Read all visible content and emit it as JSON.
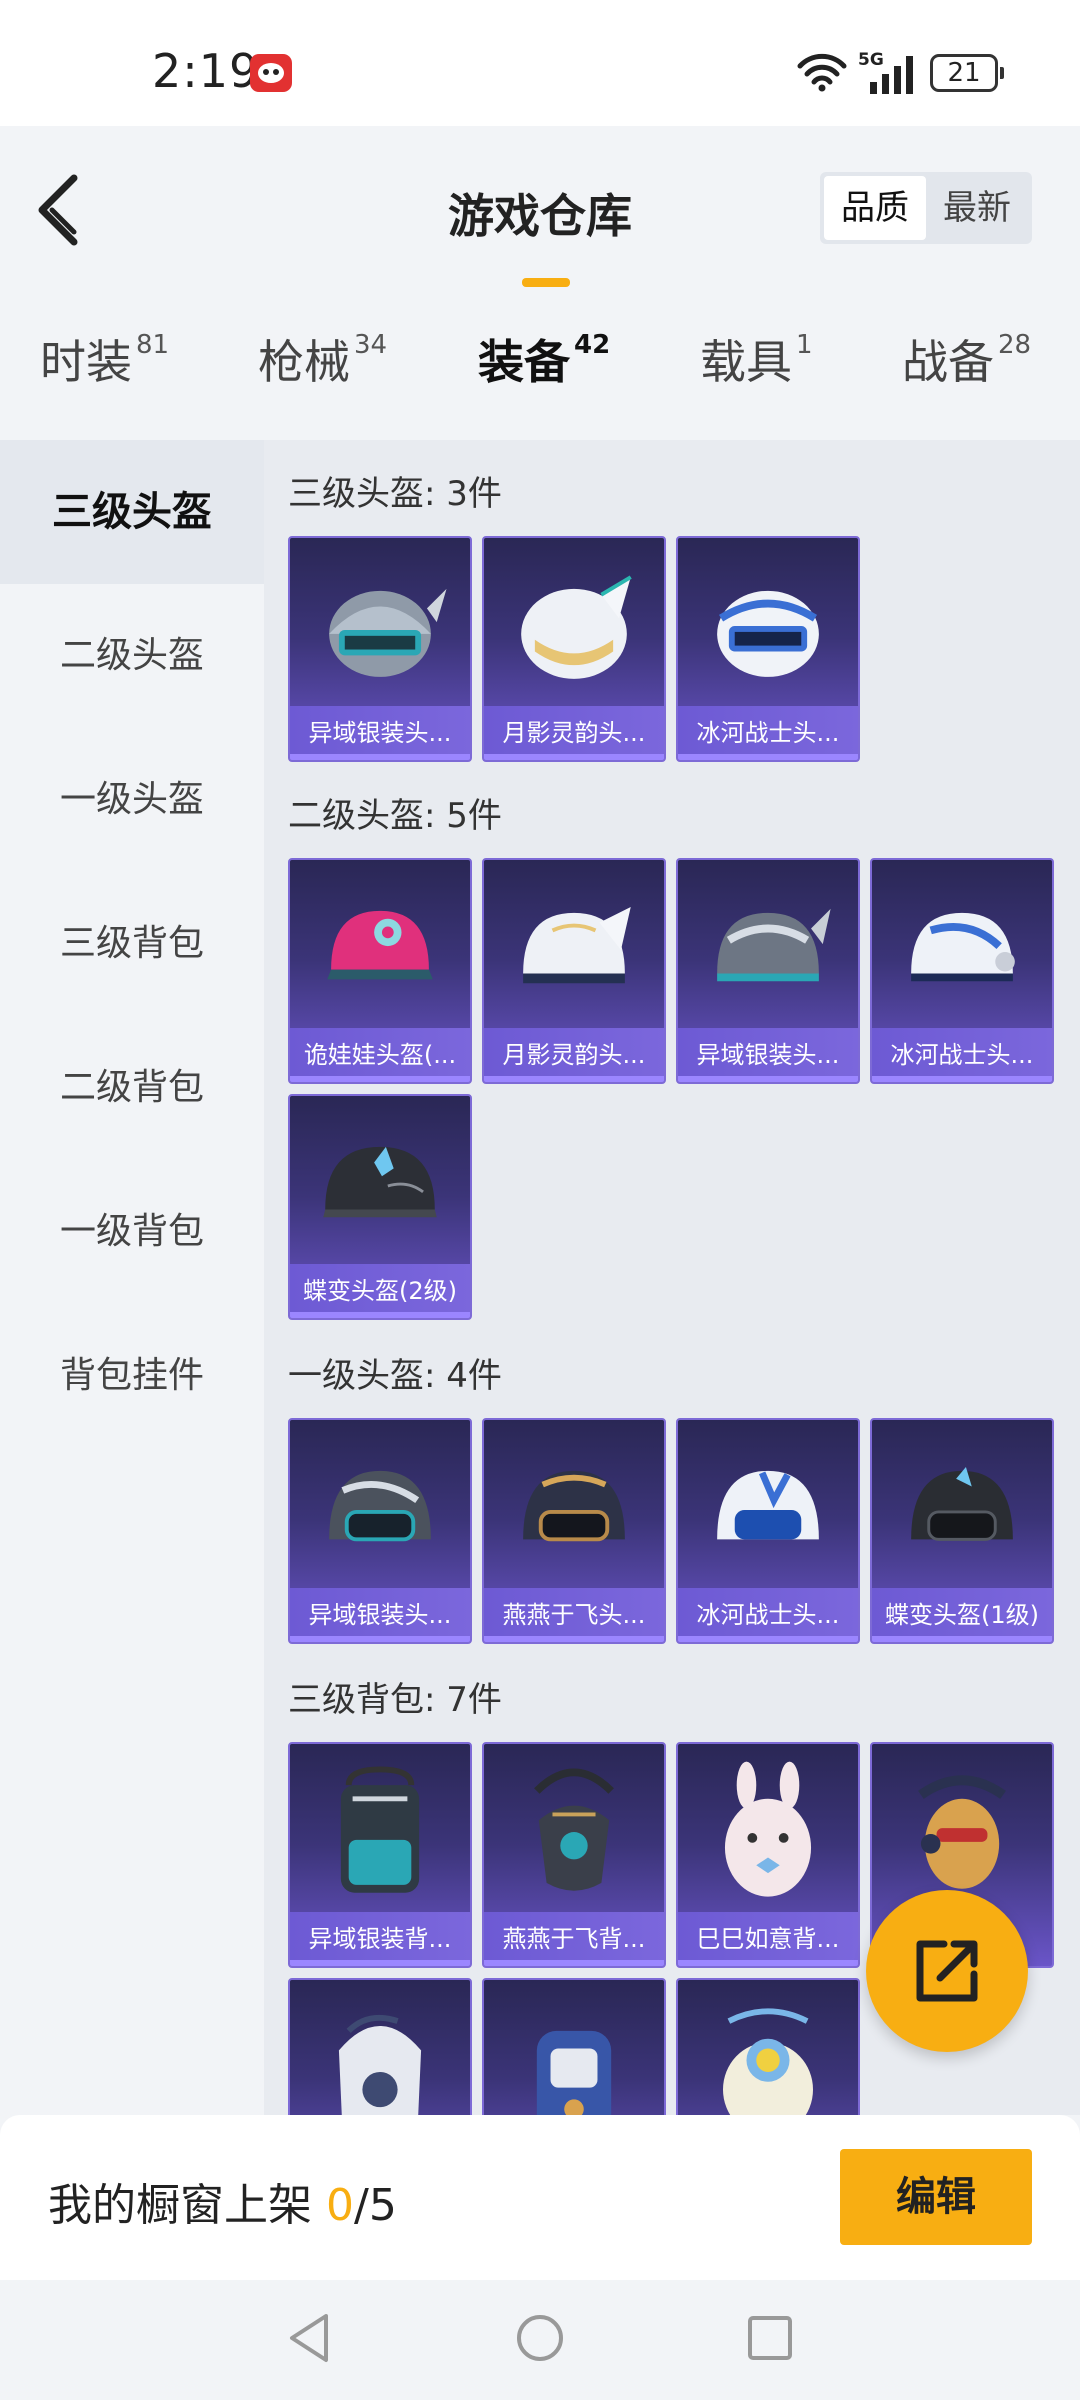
{
  "status_bar": {
    "time": "2:19",
    "network": "5G",
    "battery": "21"
  },
  "header": {
    "title": "游戏仓库",
    "sort_options": [
      "品质",
      "最新"
    ],
    "sort_active": "品质"
  },
  "tabs": [
    {
      "label": "时装",
      "count": "81",
      "active": false
    },
    {
      "label": "枪械",
      "count": "34",
      "active": false
    },
    {
      "label": "装备",
      "count": "42",
      "active": true
    },
    {
      "label": "载具",
      "count": "1",
      "active": false
    },
    {
      "label": "战备",
      "count": "28",
      "active": false
    }
  ],
  "sidebar": {
    "items": [
      {
        "label": "三级头盔",
        "active": true
      },
      {
        "label": "二级头盔",
        "active": false
      },
      {
        "label": "一级头盔",
        "active": false
      },
      {
        "label": "三级背包",
        "active": false
      },
      {
        "label": "二级背包",
        "active": false
      },
      {
        "label": "一级背包",
        "active": false
      },
      {
        "label": "背包挂件",
        "active": false
      }
    ]
  },
  "sections": [
    {
      "title": "三级头盔: 3件",
      "items": [
        {
          "name": "异域银装头...",
          "icon": "helmet-visor-icon"
        },
        {
          "name": "月影灵韵头...",
          "icon": "helmet-white-gold-icon"
        },
        {
          "name": "冰河战士头...",
          "icon": "helmet-visor-blue-icon"
        }
      ]
    },
    {
      "title": "二级头盔: 5件",
      "items": [
        {
          "name": "诡娃娃头盔(...",
          "icon": "helmet-pink-icon"
        },
        {
          "name": "月影灵韵头...",
          "icon": "helmet-white-gold-icon"
        },
        {
          "name": "异域银装头...",
          "icon": "helmet-silver-icon"
        },
        {
          "name": "冰河战士头...",
          "icon": "helmet-white-blue-icon"
        },
        {
          "name": "蝶变头盔(2级)",
          "icon": "helmet-black-icon"
        }
      ]
    },
    {
      "title": "一级头盔: 4件",
      "items": [
        {
          "name": "异域银装头...",
          "icon": "helmet-silver-icon"
        },
        {
          "name": "燕燕于飞头...",
          "icon": "helmet-dark-gold-icon"
        },
        {
          "name": "冰河战士头...",
          "icon": "helmet-white-blue-icon"
        },
        {
          "name": "蝶变头盔(1级)",
          "icon": "helmet-black-icon"
        }
      ]
    },
    {
      "title": "三级背包: 7件",
      "items": [
        {
          "name": "异域银装背...",
          "icon": "backpack-teal-icon"
        },
        {
          "name": "燕燕于飞背...",
          "icon": "backpack-dark-icon"
        },
        {
          "name": "巳巳如意背...",
          "icon": "backpack-rabbit-icon"
        },
        {
          "name": "",
          "icon": "backpack-mascot-icon"
        },
        {
          "name": "",
          "icon": "backpack-white-icon"
        },
        {
          "name": "",
          "icon": "backpack-blue-icon"
        },
        {
          "name": "",
          "icon": "backpack-fish-icon"
        }
      ]
    }
  ],
  "bottom": {
    "shelf_label": "我的橱窗上架",
    "shelf_current": "0",
    "shelf_total": "/5",
    "edit_label": "编辑"
  },
  "colors": {
    "accent": "#f8ae12",
    "card_top": "#2a2755",
    "card_bottom": "#6a55c8",
    "label_bg": "#7b67dc"
  }
}
